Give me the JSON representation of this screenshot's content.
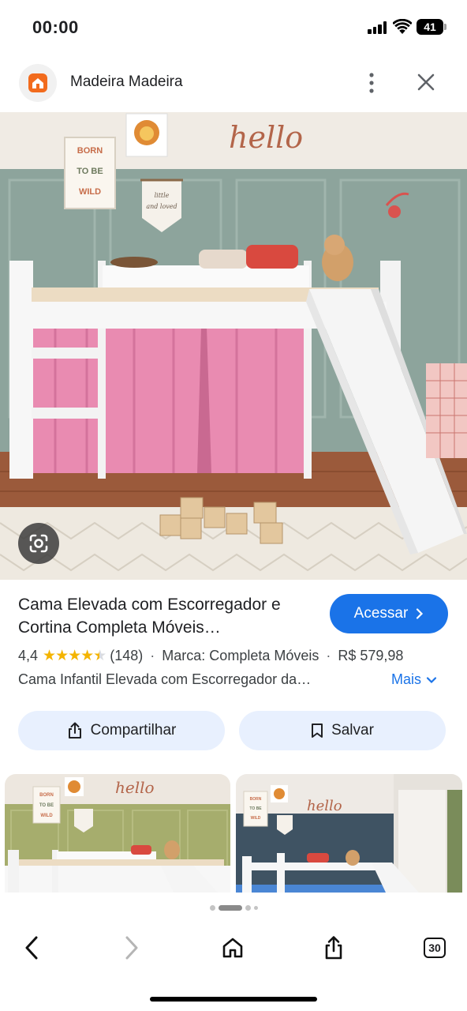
{
  "status_bar": {
    "time": "00:00",
    "battery": "41"
  },
  "header": {
    "site_name": "Madeira Madeira",
    "logo_icon": "madeira-house-logo",
    "more_icon": "more-vert-icon",
    "close_icon": "close-icon"
  },
  "hero": {
    "lens_icon": "google-lens-icon",
    "wall_letters": "hello",
    "poster_text": "BORN TO BE WILD",
    "pennant_text": "little and loved"
  },
  "product": {
    "title": "Cama Elevada com Escorregador e Cortina Completa Móveis…",
    "cta_label": "Acessar",
    "rating": "4,4",
    "rating_value": 4.4,
    "rating_max": 5,
    "review_count": "(148)",
    "brand": "Marca: Completa Móveis",
    "price": "R$ 579,98",
    "description": "Cama Infantil Elevada com Escorregador da…",
    "more_label": "Mais"
  },
  "actions": {
    "share_label": "Compartilhar",
    "save_label": "Salvar"
  },
  "thumbnails": {
    "thumb1_text": "hello",
    "thumb2_text": "hello",
    "thumb_poster_text": "BORN TO BE WILD"
  },
  "toolbar": {
    "back_icon": "back-arrow-icon",
    "forward_icon": "forward-arrow-icon",
    "home_icon": "home-icon",
    "share_icon": "share-icon",
    "tabs_count": "30"
  },
  "colors": {
    "accent_blue": "#1a73e8",
    "pill_bg": "#e8f0fe",
    "star": "#f4b400",
    "curtain_pink": "#e98bb1",
    "wall_green": "#8da49c"
  }
}
